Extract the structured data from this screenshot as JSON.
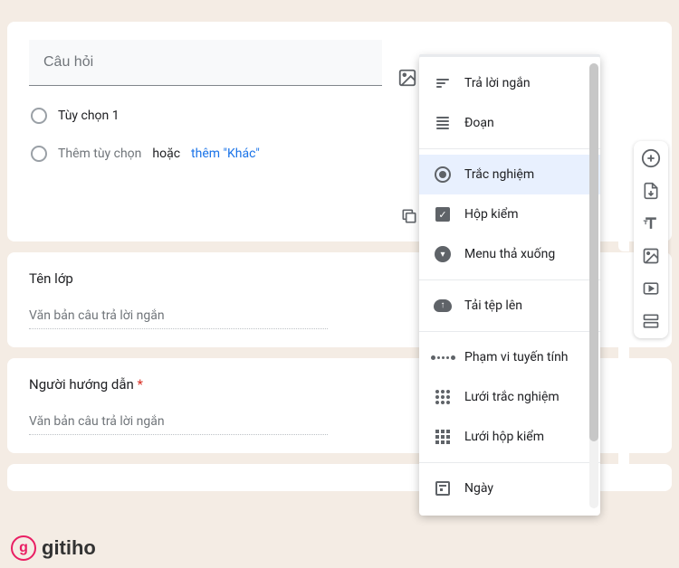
{
  "question": {
    "placeholder": "Câu hỏi",
    "option1": "Tùy chọn 1",
    "add_option": "Thêm tùy chọn",
    "or": "hoặc",
    "add_other": "thêm \"Khác\""
  },
  "fields": {
    "class_label": "Tên lớp",
    "instructor_label": "Người hướng dẫn",
    "short_answer_placeholder": "Văn bản câu trả lời ngắn"
  },
  "menu": {
    "short_answer": "Trả lời ngắn",
    "paragraph": "Đoạn",
    "multiple_choice": "Trắc nghiệm",
    "checkboxes": "Hộp kiểm",
    "dropdown": "Menu thả xuống",
    "file_upload": "Tải tệp lên",
    "linear_scale": "Phạm vi tuyến tính",
    "mc_grid": "Lưới trắc nghiệm",
    "checkbox_grid": "Lưới hộp kiểm",
    "date": "Ngày"
  },
  "watermark": "gitiho"
}
